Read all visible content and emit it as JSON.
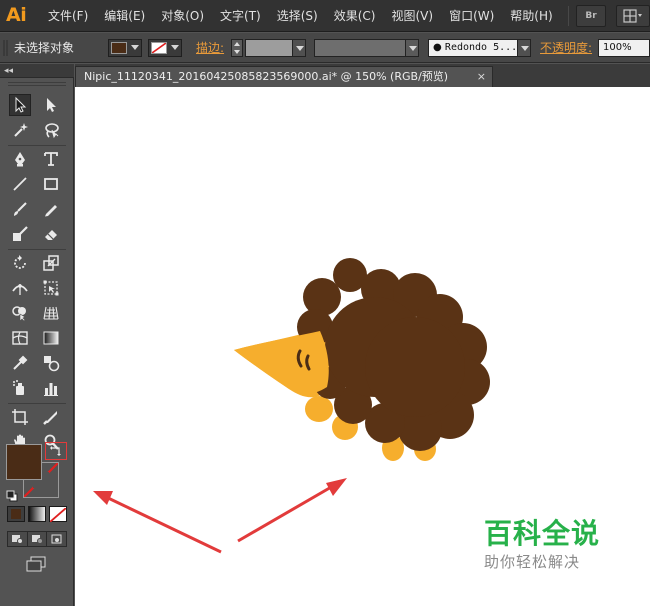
{
  "app": {
    "logo": "Ai",
    "brand_color": "#f29a1e"
  },
  "menu": {
    "items": [
      "文件(F)",
      "编辑(E)",
      "对象(O)",
      "文字(T)",
      "选择(S)",
      "效果(C)",
      "视图(V)",
      "窗口(W)",
      "帮助(H)"
    ],
    "bridge_button": "Br"
  },
  "controlbar": {
    "selection_status": "未选择对象",
    "fill_color": "#4a2c16",
    "stroke_color": "none",
    "stroke_label": "描边:",
    "stroke_weight": "",
    "brush_style": "Redondo 5...",
    "opacity_label": "不透明度:",
    "opacity_value": "100%"
  },
  "document": {
    "tab_title": "Nipic_11120341_20160425085823569000.ai* @ 150% (RGB/预览)",
    "close_label": "×"
  },
  "tools_panel": {
    "collapse_label": "◂◂",
    "icons": [
      "selection-tool-icon",
      "direct-selection-tool-icon",
      "magic-wand-tool-icon",
      "lasso-tool-icon",
      "pen-tool-icon",
      "type-tool-icon",
      "line-segment-tool-icon",
      "rectangle-tool-icon",
      "paintbrush-tool-icon",
      "pencil-tool-icon",
      "blob-brush-tool-icon",
      "eraser-tool-icon",
      "rotate-tool-icon",
      "scale-tool-icon",
      "width-tool-icon",
      "free-transform-tool-icon",
      "shape-builder-tool-icon",
      "perspective-grid-tool-icon",
      "mesh-tool-icon",
      "gradient-tool-icon",
      "eyedropper-tool-icon",
      "blend-tool-icon",
      "symbol-sprayer-tool-icon",
      "column-graph-tool-icon",
      "artboard-tool-icon",
      "slice-tool-icon",
      "hand-tool-icon",
      "zoom-tool-icon"
    ],
    "fill_swatch": "#4a2c16",
    "stroke_swatch": "none",
    "active_tool": "selection-tool-icon"
  },
  "artwork": {
    "hedgehog_body_color": "#5a3315",
    "hedgehog_face_color": "#f6ae2d",
    "arrow_color": "#e23b3b"
  },
  "watermark": {
    "title": "百科全说",
    "subtitle": "助你轻松解决",
    "title_color": "#27b14a"
  }
}
